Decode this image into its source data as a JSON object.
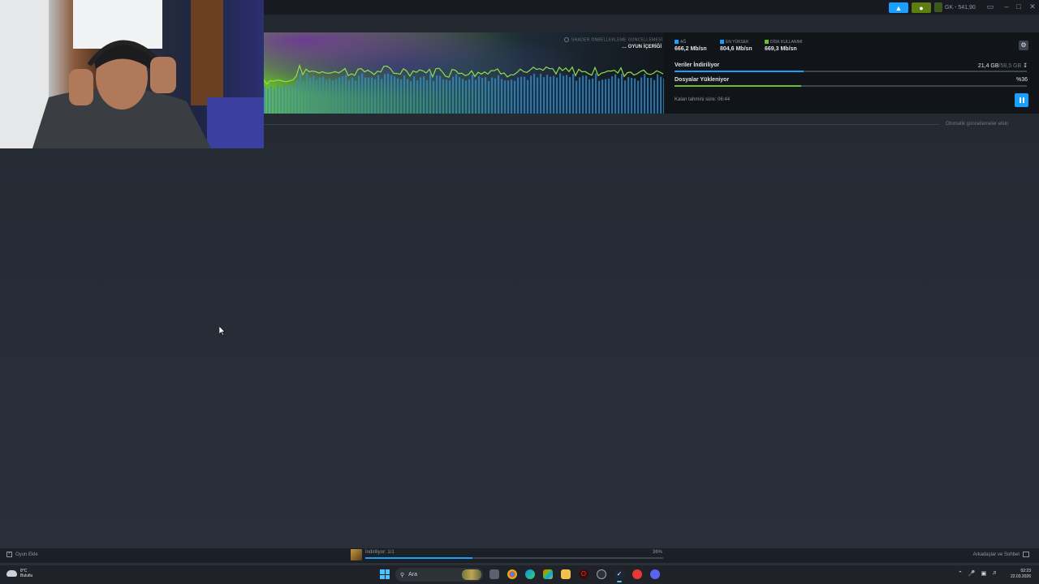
{
  "topbar": {
    "wallet_text": "GK - 541,90",
    "announce_icon": "megaphone-icon",
    "notify_icon": "bell-icon"
  },
  "download": {
    "shader_label": "SHADER ÖNBELLEKLEME GÜNCELLEMESİ",
    "content_label": "OYUN İÇERİĞİ",
    "stats": [
      {
        "label": "AĞ",
        "value": "666,2 Mb/sn",
        "color": "#1a9fff"
      },
      {
        "label": "EN YÜKSEK",
        "value": "804,6 Mb/sn",
        "color": "#1a9fff"
      },
      {
        "label": "DİSK KULLANIMI",
        "value": "669,3 Mb/sn",
        "color": "#6ebd2b"
      }
    ],
    "rows": [
      {
        "label": "Veriler İndiriliyor",
        "right_main": "21,4 GB",
        "right_dim": "/58,5 GB",
        "progress": 0.366,
        "color": "#1a9fff"
      },
      {
        "label": "Dosyalar Yükleniyor",
        "right_main": "%36",
        "right_dim": "",
        "progress": 0.36,
        "color": "#6ebd2b"
      }
    ],
    "eta": "Kalan tahmini süre: 06:44",
    "auto_updates": "Otomatik güncellemeler etkin"
  },
  "bottombar": {
    "add_game": "Oyun Ekle",
    "downloading": "İndiriliyor: 1/1",
    "percent_text": "36%",
    "progress": 0.36,
    "friends": "Arkadaşlar ve Sohbet"
  },
  "taskbar": {
    "weather_temp": "8°C",
    "weather_desc": "Bulutlu",
    "search_placeholder": "Ara",
    "time": "02:23",
    "date": "22.03.2026"
  }
}
